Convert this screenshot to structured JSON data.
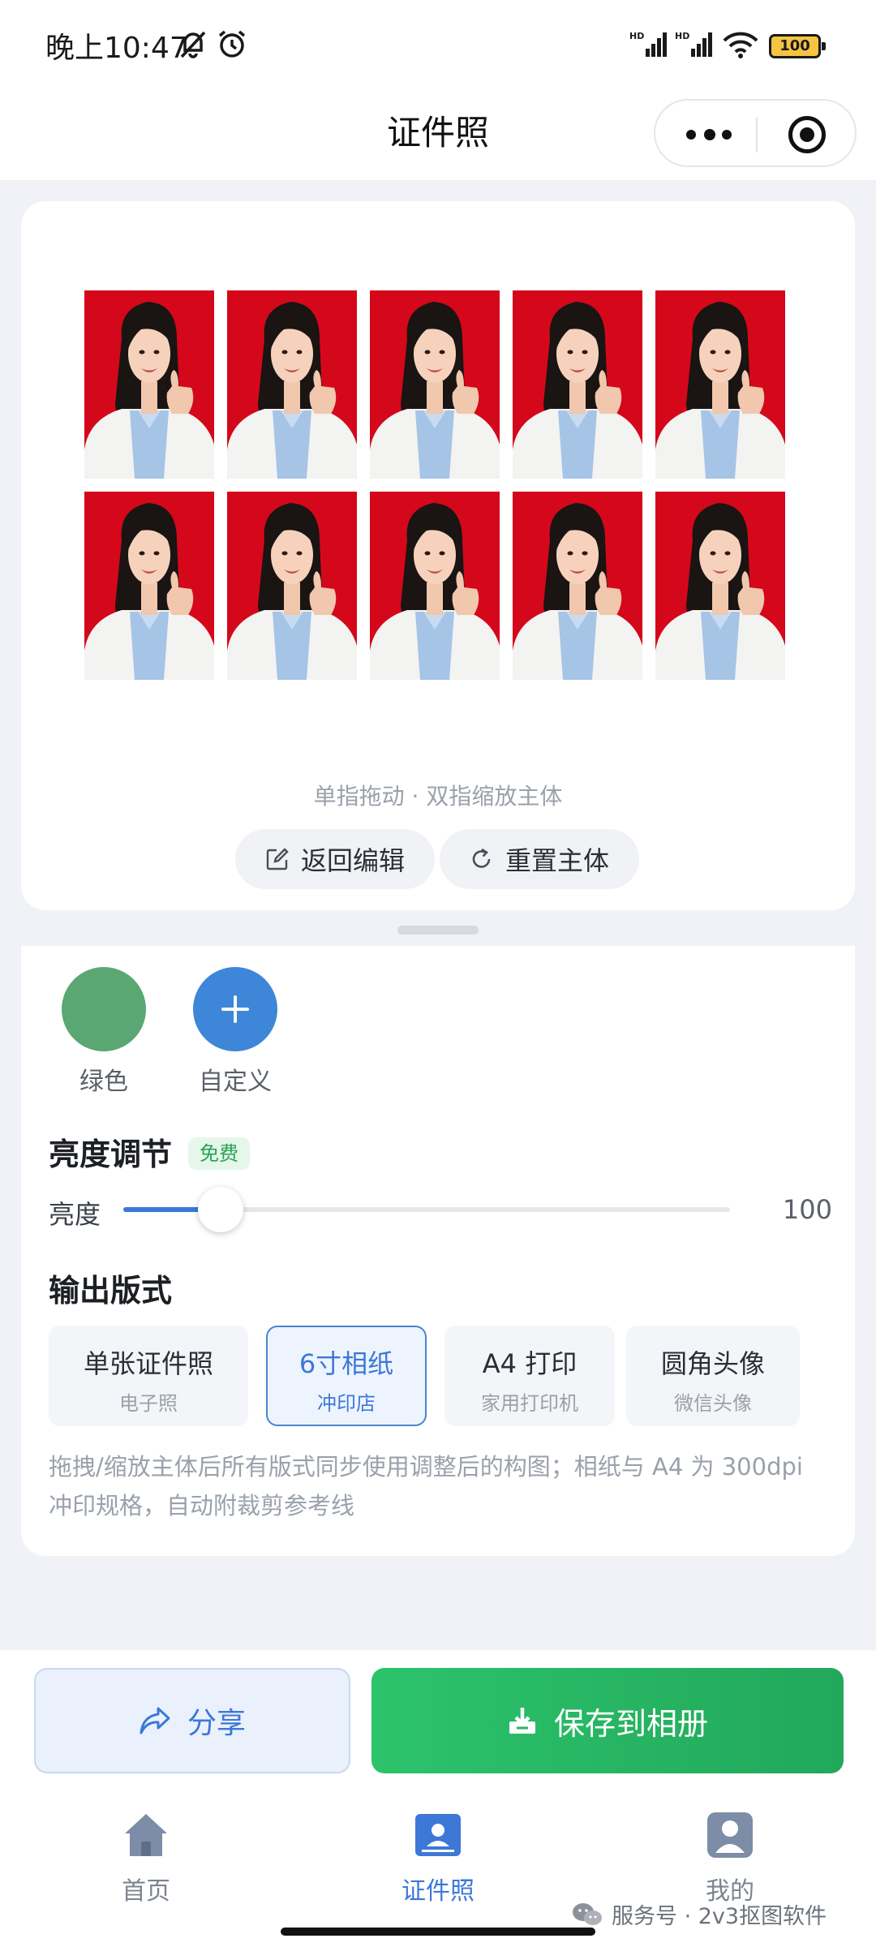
{
  "status_bar": {
    "time": "晚上10:47",
    "battery": "100",
    "icons": [
      "mute-bell-icon",
      "alarm-icon",
      "hd-signal-icon",
      "hd-signal-icon",
      "wifi-icon",
      "battery-icon"
    ]
  },
  "nav": {
    "title": "证件照",
    "icons": [
      "more-icon",
      "close-target-icon"
    ]
  },
  "preview": {
    "photo_count": 10,
    "photo_background": "#d4081a",
    "hint": "单指拖动 · 双指缩放主体",
    "edit_button": "返回编辑",
    "reset_button": "重置主体"
  },
  "colors": {
    "items": [
      {
        "label": "绿色",
        "color": "#5ba773"
      },
      {
        "label": "自定义",
        "color": "#3d86d8",
        "icon": "plus-icon"
      }
    ]
  },
  "brightness": {
    "section_title": "亮度调节",
    "badge": "免费",
    "slider_label": "亮度",
    "value": "100",
    "fill_fraction": 0.16
  },
  "output": {
    "section_title": "输出版式",
    "formats": [
      {
        "title": "单张证件照",
        "subtitle": "电子照",
        "selected": false
      },
      {
        "title": "6寸相纸",
        "subtitle": "冲印店",
        "selected": true
      },
      {
        "title": "A4 打印",
        "subtitle": "家用打印机",
        "selected": false
      },
      {
        "title": "圆角头像",
        "subtitle": "微信头像",
        "selected": false
      }
    ],
    "note": "拖拽/缩放主体后所有版式同步使用调整后的构图；相纸与 A4 为 300dpi 冲印规格，自动附裁剪参考线"
  },
  "actions": {
    "share": "分享",
    "save": "保存到相册"
  },
  "tabbar": {
    "items": [
      {
        "label": "首页",
        "icon": "home-icon",
        "active": false
      },
      {
        "label": "证件照",
        "icon": "id-card-icon",
        "active": true
      },
      {
        "label": "我的",
        "icon": "user-icon",
        "active": false
      }
    ]
  },
  "watermark": "服务号 · 2v3抠图软件",
  "accent_color": "#3d78d6",
  "save_color": "#22a85b"
}
